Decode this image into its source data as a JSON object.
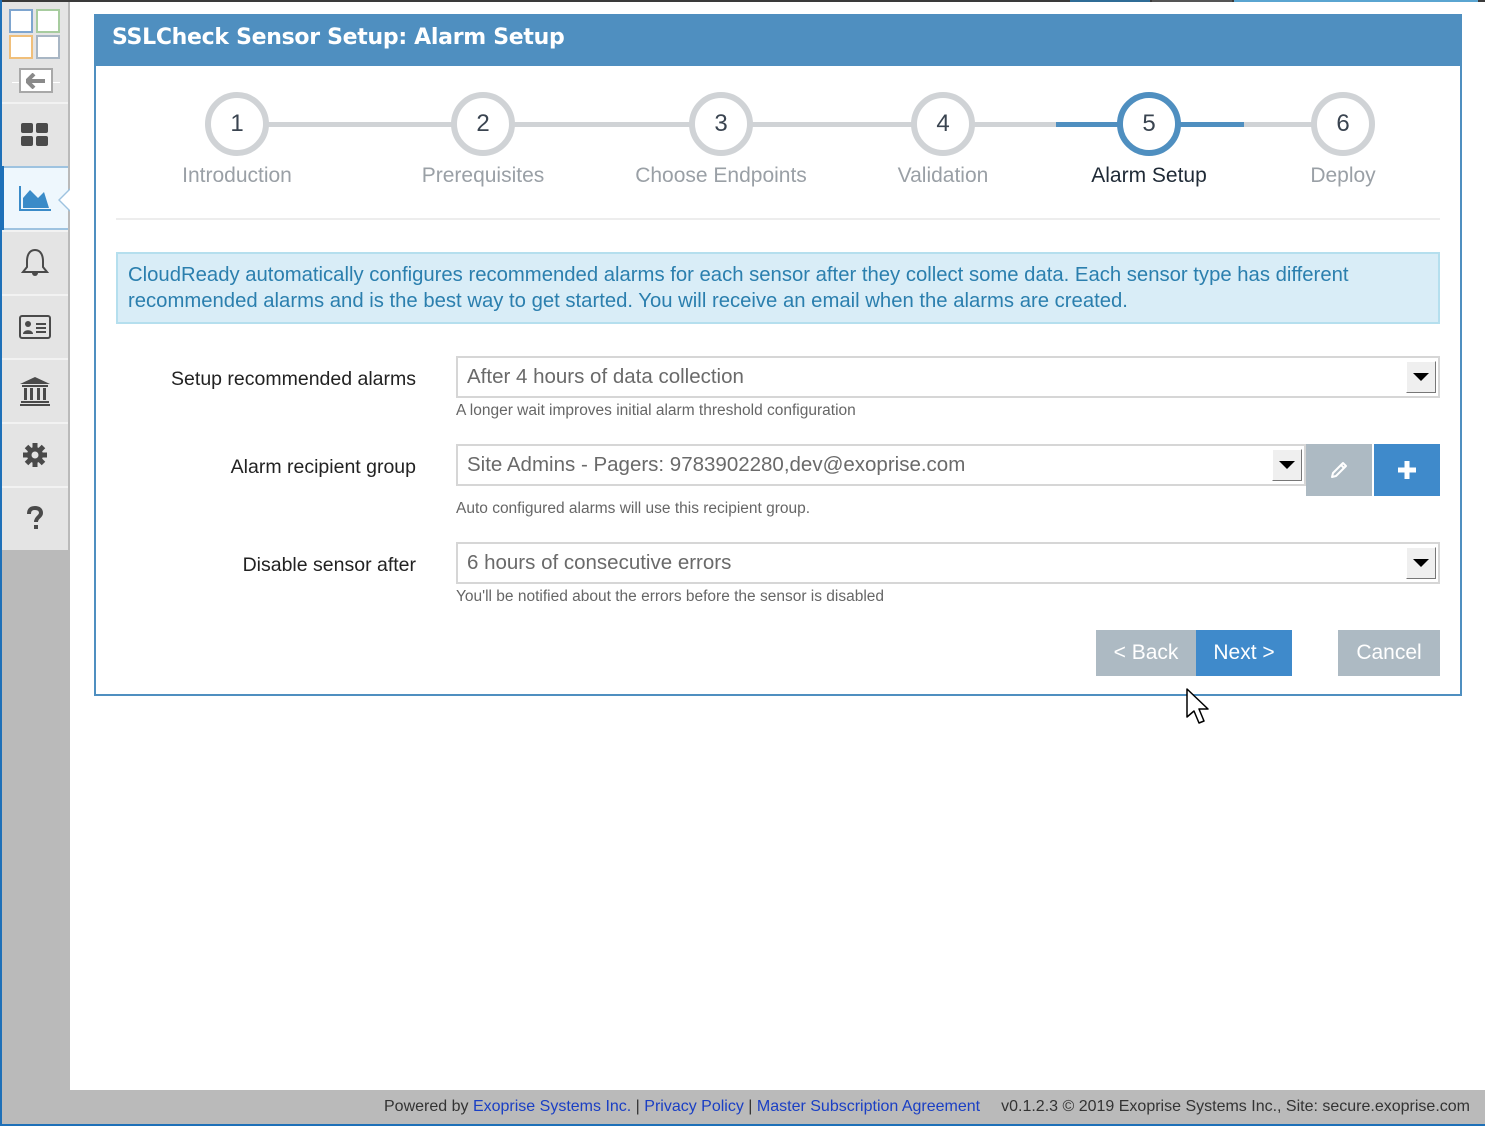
{
  "window": {
    "title": "SSLCheck Sensor Setup: Alarm Setup"
  },
  "sidebar": {
    "logo_icon": "exoprise-logo-icon",
    "back_icon": "arrow-left-icon",
    "items": [
      {
        "name": "dashboard",
        "icon": "grid-icon",
        "active": false
      },
      {
        "name": "sensors",
        "icon": "area-chart-icon",
        "active": true
      },
      {
        "name": "alarms",
        "icon": "bell-icon",
        "active": false
      },
      {
        "name": "contacts",
        "icon": "id-card-icon",
        "active": false
      },
      {
        "name": "organization",
        "icon": "bank-icon",
        "active": false
      },
      {
        "name": "settings",
        "icon": "gear-icon",
        "active": false
      },
      {
        "name": "help",
        "icon": "question-icon",
        "active": false
      }
    ]
  },
  "wizard": {
    "current_step": 5,
    "steps": [
      {
        "number": "1",
        "label": "Introduction"
      },
      {
        "number": "2",
        "label": "Prerequisites"
      },
      {
        "number": "3",
        "label": "Choose Endpoints"
      },
      {
        "number": "4",
        "label": "Validation"
      },
      {
        "number": "5",
        "label": "Alarm Setup"
      },
      {
        "number": "6",
        "label": "Deploy"
      }
    ]
  },
  "info": {
    "text": "CloudReady automatically configures recommended alarms for each sensor after they collect some data. Each sensor type has different recommended alarms and is the best way to get started. You will receive an email when the alarms are created."
  },
  "form": {
    "setup_alarms": {
      "label": "Setup recommended alarms",
      "value": "After 4 hours of data collection",
      "help": "A longer wait improves initial alarm threshold configuration"
    },
    "recipient_group": {
      "label": "Alarm recipient group",
      "value": "Site Admins - Pagers: 9783902280,dev@exoprise.com",
      "help": "Auto configured alarms will use this recipient group.",
      "edit_icon": "pencil-icon",
      "add_icon": "plus-icon"
    },
    "disable_sensor": {
      "label": "Disable sensor after",
      "value": "6 hours of consecutive errors",
      "help": "You'll be notified about the errors before the sensor is disabled"
    }
  },
  "buttons": {
    "back": "< Back",
    "next": "Next >",
    "cancel": "Cancel"
  },
  "footer": {
    "powered_by": "Powered by",
    "company_link": "Exoprise Systems Inc.",
    "sep1": " | ",
    "privacy_link": "Privacy Policy",
    "sep2": " | ",
    "msa_link": "Master Subscription Agreement",
    "version_info": "v0.1.2.3 © 2019 Exoprise Systems Inc., Site: secure.exoprise.com"
  },
  "colors": {
    "primary": "#4f8fc0",
    "button_primary": "#3f8acb",
    "button_secondary": "#adbac3",
    "info_bg": "#d9edf7",
    "info_text": "#2b7fae",
    "link": "#1a3fc4"
  }
}
